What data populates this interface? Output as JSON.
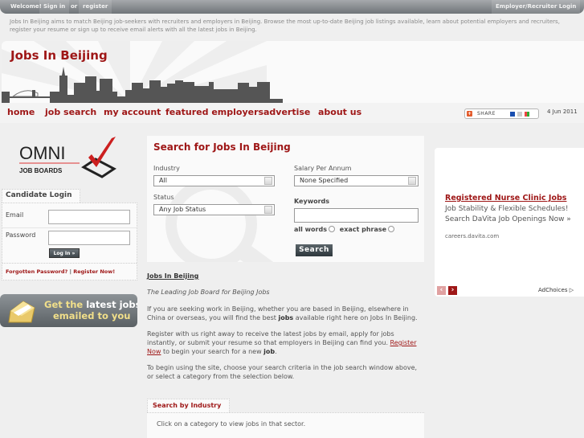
{
  "topbar": {
    "welcome": "Welcome!",
    "sign_in": "Sign in",
    "or": "or",
    "register": "register",
    "employer_login": "Employer/Recruiter Login"
  },
  "intro": "Jobs In Beijing aims to match Beijing job-seekers with recruiters and employers in Beijing. Browse the most up-to-date Beijing job listings available, learn about potential employers and recruiters, register your resume or sign up to receive email alerts with all the latest jobs in Beijing.",
  "header": {
    "title": "Jobs In Beijing"
  },
  "nav": {
    "items": [
      "home",
      "job search",
      "my account",
      "featured employers",
      "advertise",
      "about us"
    ],
    "share_label": "SHARE",
    "date": "4 Jun 2011"
  },
  "sidebar": {
    "logo_main": "OMNI",
    "logo_sub": "JOB BOARDS",
    "login_title": "Candidate Login",
    "email_label": "Email",
    "email_value": "",
    "password_label": "Password",
    "password_value": "",
    "login_button": "Log In »",
    "forgot_link": "Forgotten Password?",
    "separator": "|",
    "register_link": "Register Now!",
    "email_banner_line1_a": "Get the ",
    "email_banner_line1_b": "latest jobs",
    "email_banner_line2": "emailed to you"
  },
  "search": {
    "title": "Search for Jobs In Beijing",
    "industry_label": "Industry",
    "industry_value": "All",
    "salary_label": "Salary Per Annum",
    "salary_value": "None Specified",
    "status_label": "Status",
    "status_value": "Any Job Status",
    "keywords_label": "Keywords",
    "keywords_value": "",
    "all_words": "all words",
    "exact_phrase": "exact phrase",
    "button": "Search"
  },
  "content": {
    "heading": "Jobs In Beijing",
    "tagline": "The Leading Job Board for Beijing Jobs",
    "p1_a": "If you are seeking work in Beijing, whether you are based in Beijing, elsewhere in China or overseas, you will find the best ",
    "p1_bold": "jobs",
    "p1_b": " available right here on Jobs In Beijing.",
    "p2_a": "Register with us right away to receive the latest jobs by email, apply for jobs instantly, or submit your resume so that employers in Beijing can find you. ",
    "p2_link": "Register Now",
    "p2_b": " to begin your search for a new ",
    "p2_bold": "job",
    "p2_c": ".",
    "p3": "To begin using the site, choose your search criteria in the job search window above, or select a category from the selection below.",
    "industry_tab": "Search by Industry",
    "industry_text": "Click on a category to view jobs in that sector."
  },
  "ad": {
    "title": "Registered Nurse Clinic Jobs",
    "body": "Job Stability & Flexible Schedules! Search DaVita Job Openings Now »",
    "url": "careers.davita.com",
    "prev": "‹",
    "next": "›",
    "adchoices": "AdChoices ▷"
  },
  "colors": {
    "brand_red": "#9e1616",
    "topbar_gray": "#6f7478",
    "background": "#efefef"
  }
}
